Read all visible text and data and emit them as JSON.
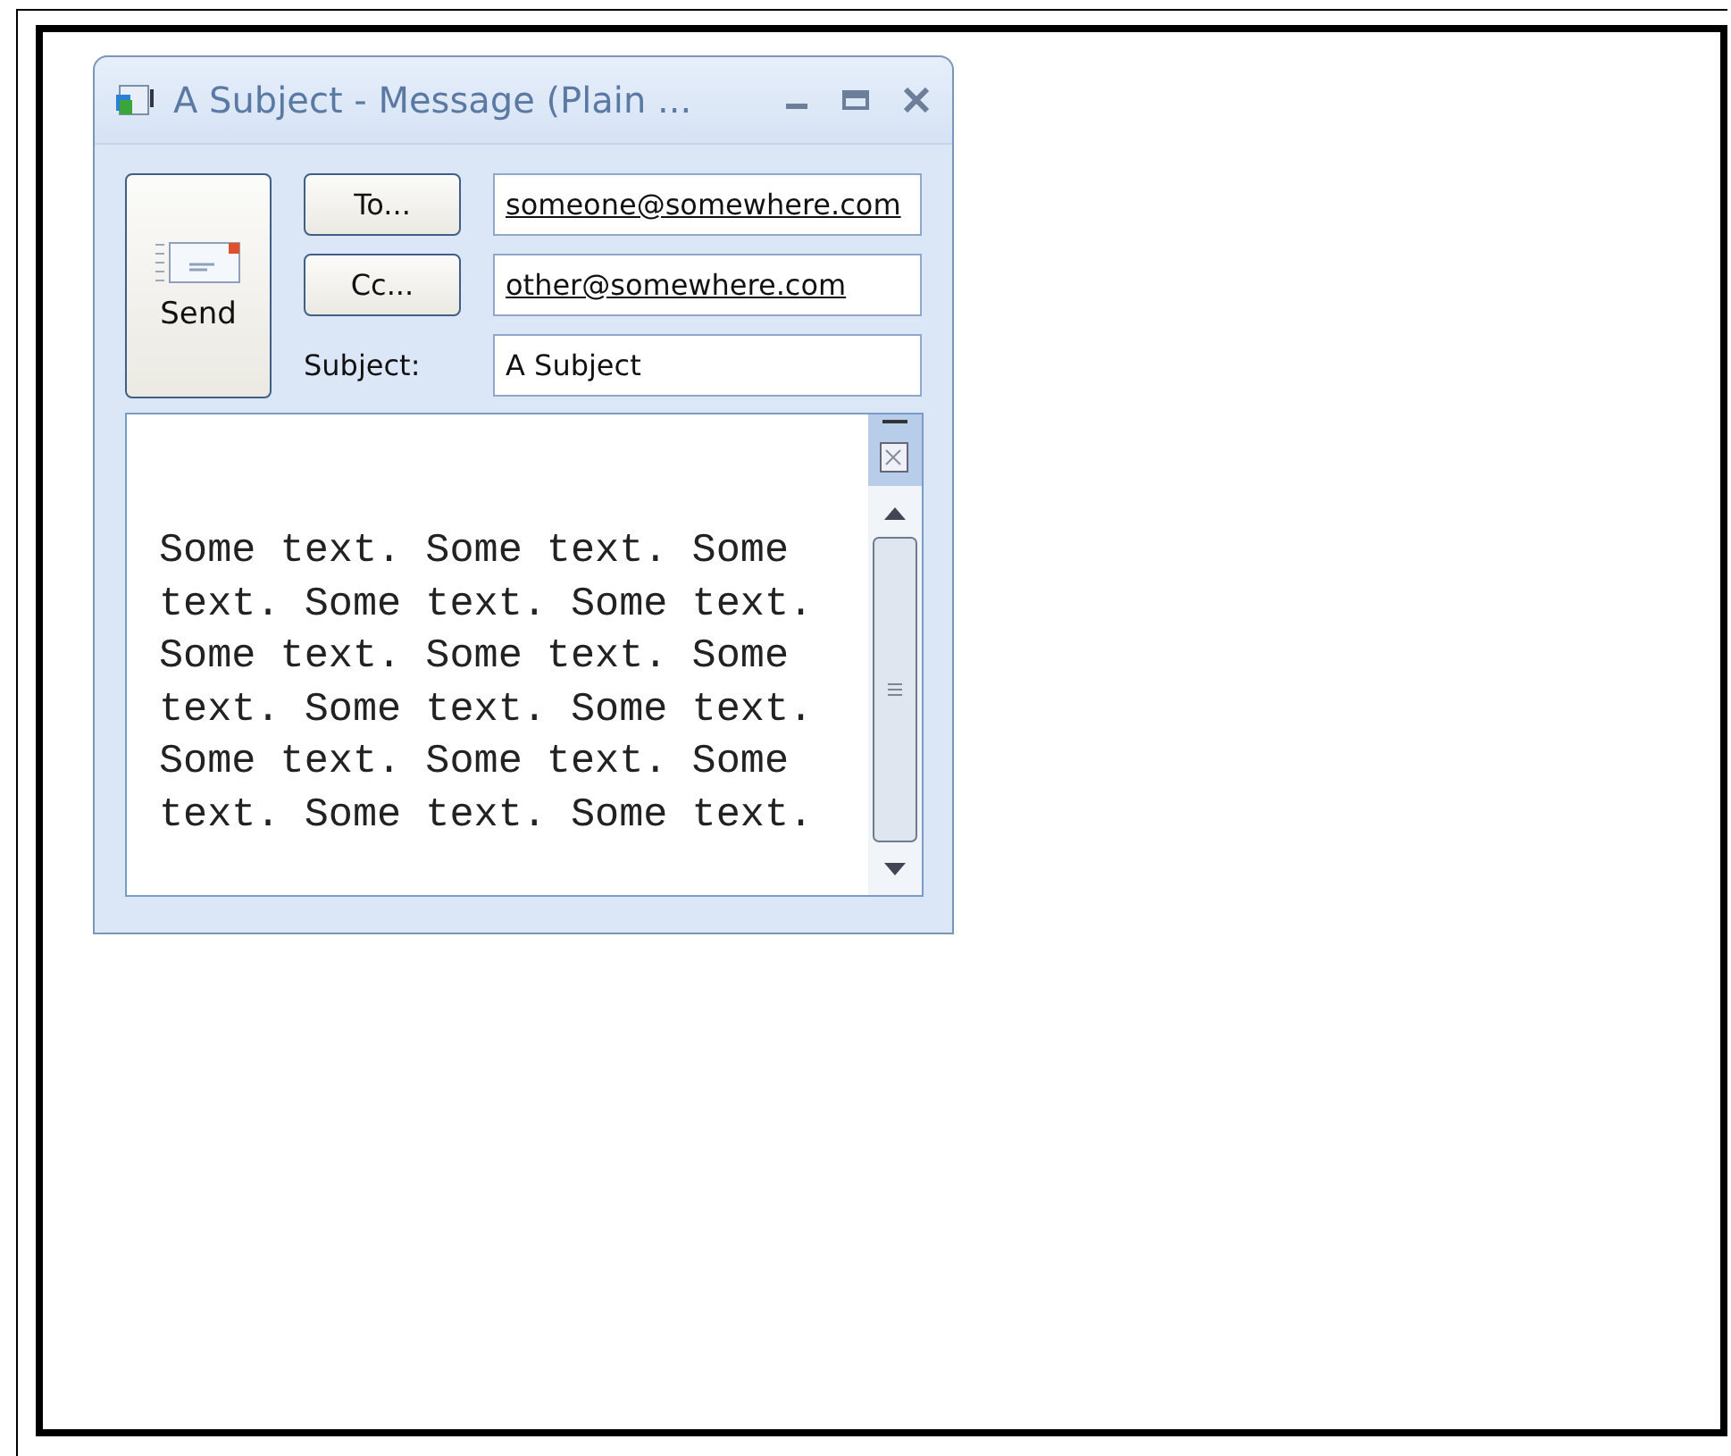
{
  "window": {
    "title": "A Subject - Message (Plain ..."
  },
  "send_button": {
    "label": "Send"
  },
  "address_fields": [
    {
      "button": "To...",
      "value": "someone@somewhere.com"
    },
    {
      "button": "Cc...",
      "value": "other@somewhere.com"
    }
  ],
  "subject": {
    "label": "Subject:",
    "value": "A Subject"
  },
  "body": {
    "text": "Some text. Some text. Some text. Some text. Some text. Some text. Some text. Some text. Some text. Some text. Some text. Some text. Some text. Some text. Some text."
  }
}
